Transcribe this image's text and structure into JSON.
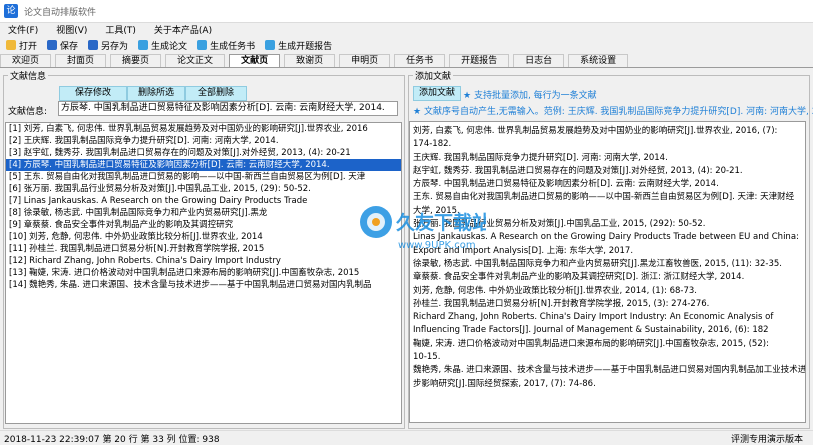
{
  "window": {
    "title": "论文自动排版软件",
    "icon": "论"
  },
  "menu": [
    "文件(F)",
    "视图(V)",
    "工具(T)",
    "关于本产品(A)"
  ],
  "toolbar": [
    {
      "label": "打开",
      "icon": "folder-open-icon"
    },
    {
      "label": "保存",
      "icon": "save-icon"
    },
    {
      "label": "另存为",
      "icon": "save-as-icon"
    },
    {
      "label": "生成论文",
      "icon": "generate-paper-icon"
    },
    {
      "label": "生成任务书",
      "icon": "generate-task-icon"
    },
    {
      "label": "生成开题报告",
      "icon": "generate-report-icon"
    }
  ],
  "tabs": [
    {
      "label": "欢迎页",
      "active": false
    },
    {
      "label": "封面页",
      "active": false
    },
    {
      "label": "摘要页",
      "active": false
    },
    {
      "label": "论文正文",
      "active": false
    },
    {
      "label": "文献页",
      "active": true
    },
    {
      "label": "致谢页",
      "active": false
    },
    {
      "label": "申明页",
      "active": false
    },
    {
      "label": "任务书",
      "active": false
    },
    {
      "label": "开题报告",
      "active": false
    },
    {
      "label": "日志台",
      "active": false
    },
    {
      "label": "系统设置",
      "active": false
    }
  ],
  "left": {
    "group_title": "文献信息",
    "buttons": {
      "save_modify": "保存修改",
      "delete_selected": "删除所选",
      "delete_all": "全部删除"
    },
    "field_label": "文献信息:",
    "field_value": "方辰琴. 中国乳制品进口贸易特征及影响因素分析[D]. 云南: 云南财经大学, 2014.",
    "items": [
      "[1] 刘芳, 白素飞, 何忠伟. 世界乳制品贸易发展趋势及对中国奶业的影响研究[J].世界农业, 2016",
      "[2] 王庆辉. 我国乳制品国际竞争力提升研究[D]. 河南: 河南大学, 2014.",
      "[3] 赵宇虹, 魏秀芬. 我国乳制品进口贸易存在的问题及对策[J].对外经贸, 2013, (4): 20-21",
      "[4] 方辰琴. 中国乳制品进口贸易特征及影响因素分析[D]. 云南: 云南财经大学, 2014.",
      "[5] 王东. 贸易自由化对我国乳制品进口贸易的影响——以中国-新西兰自由贸易区为例[D]. 天津",
      "[6] 张万丽. 我国乳品行业贸易分析及对策[J].中国乳品工业, 2015, (29): 50-52.",
      "[7] Linas Jankauskas. A Research on the Growing Dairy Products Trade",
      "[8] 徐录敏, 杨志武. 中国乳制品国际竞争力和产业内贸易研究[J].黑龙",
      "[9] 章蔡蔡. 食品安全事件对乳制品产业的影响及其调控研究",
      "[10] 刘芳, 危静, 何忠伟. 中外奶业政策比较分析[J].世界农业, 2014",
      "[11] 孙桂兰. 我国乳制品进口贸易分析[N].开封教育学院学报, 2015",
      "[12] Richard Zhang, John Roberts. China's Dairy Import Industry",
      "[13] 鞠婕, 宋涛. 进口价格波动对中国乳制品进口来源布局的影响研究[J].中国畜牧杂志, 2015",
      "[14] 魏艳秀, 朱晶. 进口来源国、技术含量与技术进步——基于中国乳制品进口贸易对国内乳制品"
    ],
    "selected_index": 3
  },
  "right": {
    "group_title": "添加文献",
    "add_button": "添加文献",
    "hint1": "支持批量添加, 每行为一条文献",
    "hint2": "文献序号自动产生,无需输入。范例: 王庆辉. 我国乳制品国际竞争力提升研究[D]. 河南: 河南大学, 2014.",
    "lines": [
      "刘芳, 白素飞, 何忠伟. 世界乳制品贸易发展趋势及对中国奶业的影响研究[J].世界农业, 2016, (7):",
      "174-182.",
      "王庆辉. 我国乳制品国际竞争力提升研究[D]. 河南: 河南大学, 2014.",
      "赵宇虹, 魏秀芬. 我国乳制品进口贸易存在的问题及对策[J].对外经贸, 2013, (4): 20-21.",
      "方辰琴. 中国乳制品进口贸易特征及影响因素分析[D]. 云南: 云南财经大学, 2014.",
      "王东. 贸易自由化对我国乳制品进口贸易的影响——以中国-新西兰自由贸易区为例[D]. 天津: 天津财经",
      "大学, 2015.",
      "张万丽. 我国乳品行业贸易分析及对策[J].中国乳品工业, 2015, (292): 50-52.",
      "Linas Jankauskas. A Research on the Growing Dairy Products Trade between EU and China:",
      "Export and Import Analysis[D]. 上海: 东华大学, 2017.",
      "徐录敏, 杨志武. 中国乳制品国际竞争力和产业内贸易研究[J].黑龙江畜牧兽医, 2015, (11): 32-35.",
      "章蔡蔡. 食品安全事件对乳制品产业的影响及其调控研究[D]. 浙江: 浙江财经大学, 2014.",
      "刘芳, 危静, 何忠伟. 中外奶业政策比较分析[J].世界农业, 2014, (1): 68-73.",
      "孙桂兰. 我国乳制品进口贸易分析[N].开封教育学院学报, 2015, (3): 274-276.",
      "Richard Zhang, John Roberts. China's Dairy Import Industry: An Economic Analysis of",
      "Influencing Trade Factors[J]. Journal of Management & Sustainability, 2016, (6): 182",
      "鞠婕, 宋涛. 进口价格波动对中国乳制品进口来源布局的影响研究[J].中国畜牧杂志, 2015, (52):",
      "10-15.",
      "魏艳秀, 朱晶. 进口来源国、技术含量与技术进步——基于中国乳制品进口贸易对国内乳制品加工业技术进",
      "步影响研究[J].国际经贸探索, 2017, (7): 74-86."
    ]
  },
  "status": {
    "left": "2018-11-23 22:39:07  第 20 行 第 33 列 位置: 938",
    "right": "评测专用演示版本"
  },
  "watermark": {
    "name": "久友下载站",
    "url": "www.9UPK.com"
  }
}
